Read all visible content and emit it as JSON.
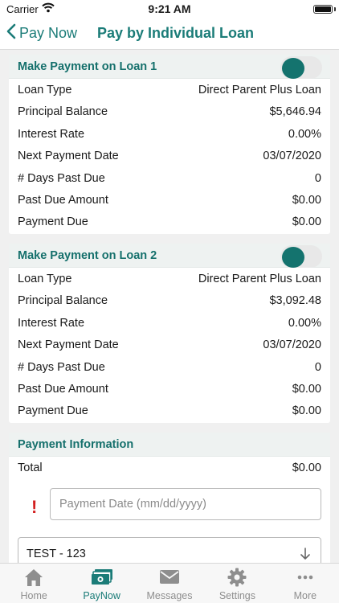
{
  "status_bar": {
    "carrier": "Carrier",
    "time": "9:21 AM"
  },
  "nav": {
    "back_label": "Pay Now",
    "title": "Pay by Individual Loan"
  },
  "colors": {
    "accent": "#1b7c78",
    "header_bg": "#eef2f1",
    "warning": "#d32020"
  },
  "loans": [
    {
      "title": "Make Payment on Loan 1",
      "toggle_on": true,
      "rows": [
        {
          "label": "Loan Type",
          "value": "Direct Parent Plus Loan"
        },
        {
          "label": "Principal Balance",
          "value": "$5,646.94"
        },
        {
          "label": "Interest Rate",
          "value": "0.00%"
        },
        {
          "label": "Next Payment Date",
          "value": "03/07/2020"
        },
        {
          "label": "# Days Past Due",
          "value": "0"
        },
        {
          "label": "Past Due Amount",
          "value": "$0.00"
        },
        {
          "label": "Payment Due",
          "value": "$0.00"
        }
      ]
    },
    {
      "title": "Make Payment on Loan 2",
      "toggle_on": true,
      "rows": [
        {
          "label": "Loan Type",
          "value": "Direct Parent Plus Loan"
        },
        {
          "label": "Principal Balance",
          "value": "$3,092.48"
        },
        {
          "label": "Interest Rate",
          "value": "0.00%"
        },
        {
          "label": "Next Payment Date",
          "value": "03/07/2020"
        },
        {
          "label": "# Days Past Due",
          "value": "0"
        },
        {
          "label": "Past Due Amount",
          "value": "$0.00"
        },
        {
          "label": "Payment Due",
          "value": "$0.00"
        }
      ]
    }
  ],
  "payment_info": {
    "title": "Payment Information",
    "total_label": "Total",
    "total_value": "$0.00",
    "warning_glyph": "!",
    "date_placeholder": "Payment Date (mm/dd/yyyy)",
    "date_value": "",
    "account_selected": "TEST - 123"
  },
  "tabs": [
    {
      "label": "Home",
      "icon": "home-icon",
      "active": false
    },
    {
      "label": "PayNow",
      "icon": "money-icon",
      "active": true
    },
    {
      "label": "Messages",
      "icon": "envelope-icon",
      "active": false
    },
    {
      "label": "Settings",
      "icon": "gear-icon",
      "active": false
    },
    {
      "label": "More",
      "icon": "more-icon",
      "active": false
    }
  ]
}
